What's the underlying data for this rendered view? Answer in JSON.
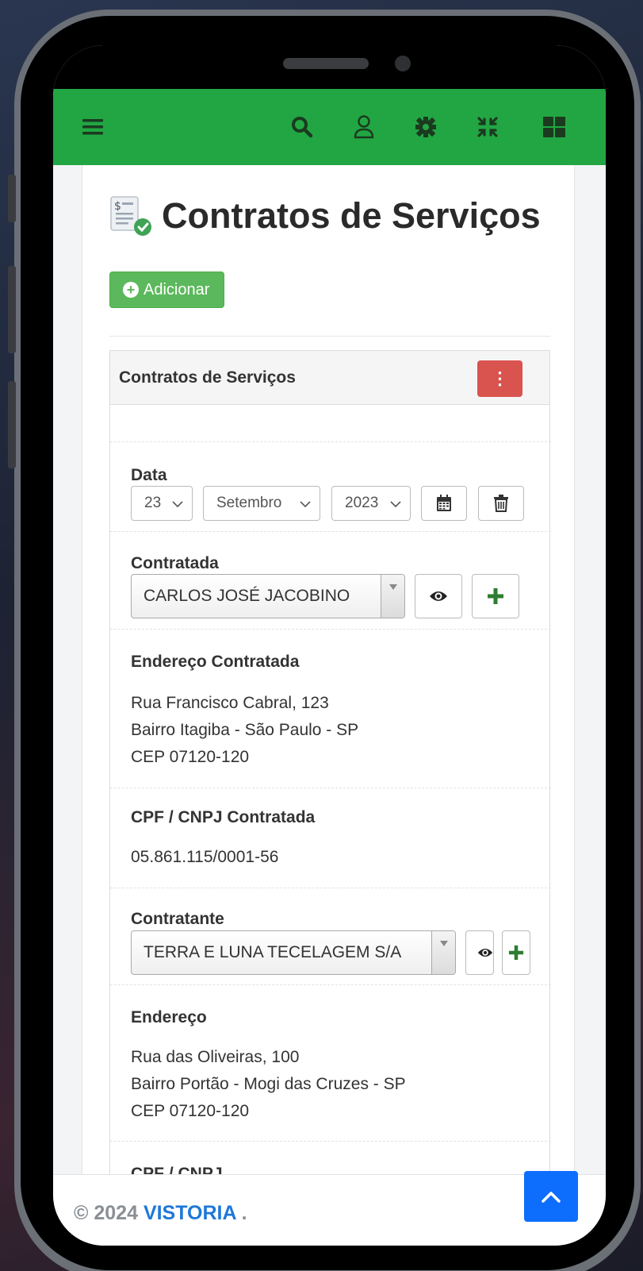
{
  "topbar": {
    "bg_color": "#22a643",
    "icons": [
      "menu-icon",
      "search-icon",
      "user-icon",
      "gear-icon",
      "compress-icon",
      "grid-icon"
    ]
  },
  "page": {
    "title": "Contratos de Serviços"
  },
  "actions": {
    "add_label": "Adicionar"
  },
  "panel": {
    "title": "Contratos de Serviços",
    "menu_label": "⋮"
  },
  "form": {
    "data": {
      "label": "Data",
      "day": "23",
      "month": "Setembro",
      "year": "2023"
    },
    "contratada": {
      "label": "Contratada",
      "value": "CARLOS JOSÉ JACOBINO"
    },
    "endereco_contratada": {
      "label": "Endereço Contratada",
      "line1": "Rua Francisco Cabral, 123",
      "line2": "Bairro Itagiba - São Paulo - SP",
      "line3": "CEP 07120-120"
    },
    "cpf_contratada": {
      "label": "CPF / CNPJ Contratada",
      "value": "05.861.115/0001-56"
    },
    "contratante": {
      "label": "Contratante",
      "value": "TERRA E LUNA TECELAGEM S/A"
    },
    "endereco": {
      "label": "Endereço",
      "line1": "Rua das Oliveiras, 100",
      "line2": "Bairro Portão - Mogi das Cruzes - SP",
      "line3": "CEP 07120-120"
    },
    "cpf_cut": {
      "label": "CPF / CNPJ"
    }
  },
  "footer": {
    "copyright": "© 2024",
    "brand": "VISTORIA",
    "suffix": " ."
  }
}
